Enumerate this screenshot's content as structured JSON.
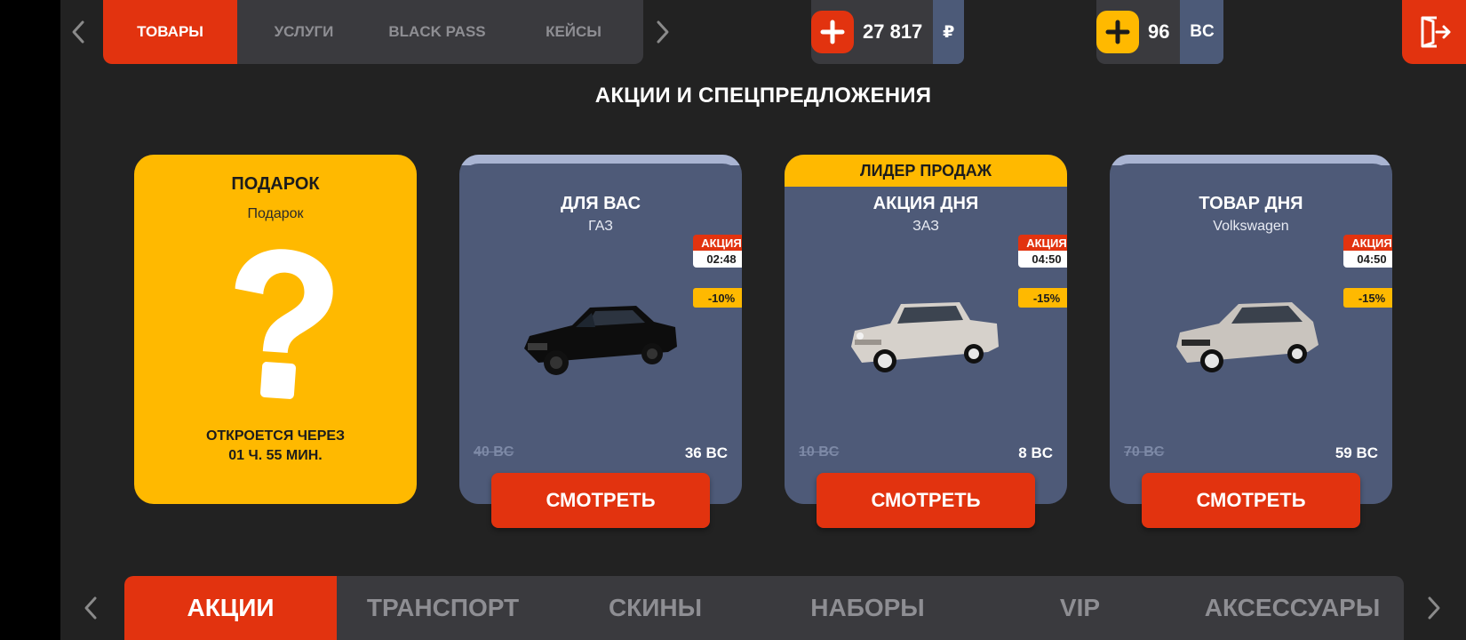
{
  "top_tabs": [
    "ТОВАРЫ",
    "УСЛУГИ",
    "BLACK PASS",
    "КЕЙСЫ"
  ],
  "currency_rub": {
    "amount": "27 817",
    "unit": "₽"
  },
  "currency_bc": {
    "amount": "96",
    "unit": "BC"
  },
  "page_title": "АКЦИИ И СПЕЦПРЕДЛОЖЕНИЯ",
  "gift": {
    "title": "ПОДАРОК",
    "subtitle": "Подарок",
    "opens_line1": "ОТКРОЕТСЯ ЧЕРЕЗ",
    "opens_line2": "01 Ч. 55 МИН."
  },
  "offers": [
    {
      "leader": "",
      "title": "ДЛЯ ВАС",
      "subtitle": "ГАЗ",
      "badge": "АКЦИЯ",
      "timer": "02:48",
      "discount": "-10%",
      "old_price": "40 BC",
      "new_price": "36 BC",
      "button": "СМОТРЕТЬ",
      "car_color": "#0d0d0d"
    },
    {
      "leader": "ЛИДЕР ПРОДАЖ",
      "title": "АКЦИЯ ДНЯ",
      "subtitle": "ЗАЗ",
      "badge": "АКЦИЯ",
      "timer": "04:50",
      "discount": "-15%",
      "old_price": "10 BC",
      "new_price": "8 BC",
      "button": "СМОТРЕТЬ",
      "car_color": "#d6d1cb"
    },
    {
      "leader": "",
      "title": "ТОВАР ДНЯ",
      "subtitle": "Volkswagen",
      "badge": "АКЦИЯ",
      "timer": "04:50",
      "discount": "-15%",
      "old_price": "70 BC",
      "new_price": "59 BC",
      "button": "СМОТРЕТЬ",
      "car_color": "#c9c4be"
    }
  ],
  "categories": [
    "АКЦИИ",
    "ТРАНСПОРТ",
    "СКИНЫ",
    "НАБОРЫ",
    "VIP",
    "АКСЕССУАРЫ"
  ],
  "colors": {
    "accent": "#e2330f",
    "gold": "#ffb900",
    "card": "#4e5a78"
  }
}
